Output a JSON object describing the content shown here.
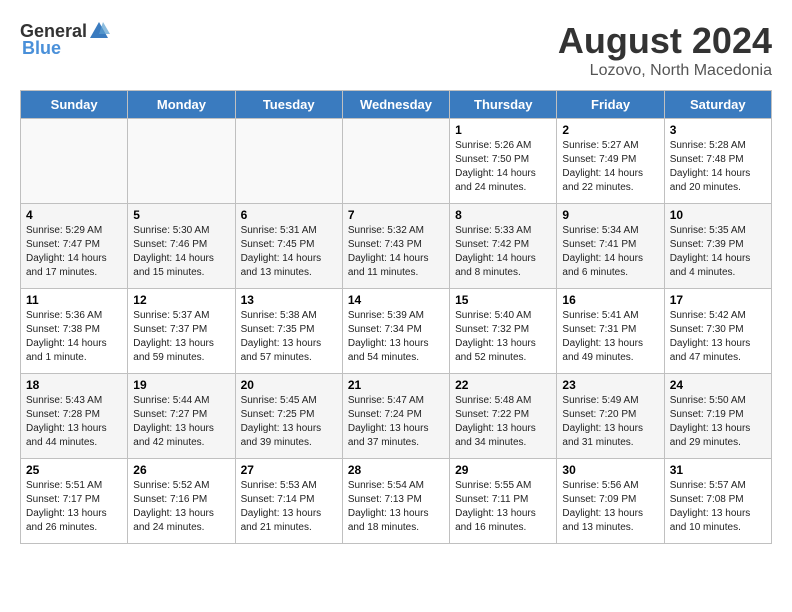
{
  "header": {
    "logo_general": "General",
    "logo_blue": "Blue",
    "month_title": "August 2024",
    "location": "Lozovo, North Macedonia"
  },
  "days_of_week": [
    "Sunday",
    "Monday",
    "Tuesday",
    "Wednesday",
    "Thursday",
    "Friday",
    "Saturday"
  ],
  "weeks": [
    [
      {
        "day": "",
        "info": ""
      },
      {
        "day": "",
        "info": ""
      },
      {
        "day": "",
        "info": ""
      },
      {
        "day": "",
        "info": ""
      },
      {
        "day": "1",
        "info": "Sunrise: 5:26 AM\nSunset: 7:50 PM\nDaylight: 14 hours\nand 24 minutes."
      },
      {
        "day": "2",
        "info": "Sunrise: 5:27 AM\nSunset: 7:49 PM\nDaylight: 14 hours\nand 22 minutes."
      },
      {
        "day": "3",
        "info": "Sunrise: 5:28 AM\nSunset: 7:48 PM\nDaylight: 14 hours\nand 20 minutes."
      }
    ],
    [
      {
        "day": "4",
        "info": "Sunrise: 5:29 AM\nSunset: 7:47 PM\nDaylight: 14 hours\nand 17 minutes."
      },
      {
        "day": "5",
        "info": "Sunrise: 5:30 AM\nSunset: 7:46 PM\nDaylight: 14 hours\nand 15 minutes."
      },
      {
        "day": "6",
        "info": "Sunrise: 5:31 AM\nSunset: 7:45 PM\nDaylight: 14 hours\nand 13 minutes."
      },
      {
        "day": "7",
        "info": "Sunrise: 5:32 AM\nSunset: 7:43 PM\nDaylight: 14 hours\nand 11 minutes."
      },
      {
        "day": "8",
        "info": "Sunrise: 5:33 AM\nSunset: 7:42 PM\nDaylight: 14 hours\nand 8 minutes."
      },
      {
        "day": "9",
        "info": "Sunrise: 5:34 AM\nSunset: 7:41 PM\nDaylight: 14 hours\nand 6 minutes."
      },
      {
        "day": "10",
        "info": "Sunrise: 5:35 AM\nSunset: 7:39 PM\nDaylight: 14 hours\nand 4 minutes."
      }
    ],
    [
      {
        "day": "11",
        "info": "Sunrise: 5:36 AM\nSunset: 7:38 PM\nDaylight: 14 hours\nand 1 minute."
      },
      {
        "day": "12",
        "info": "Sunrise: 5:37 AM\nSunset: 7:37 PM\nDaylight: 13 hours\nand 59 minutes."
      },
      {
        "day": "13",
        "info": "Sunrise: 5:38 AM\nSunset: 7:35 PM\nDaylight: 13 hours\nand 57 minutes."
      },
      {
        "day": "14",
        "info": "Sunrise: 5:39 AM\nSunset: 7:34 PM\nDaylight: 13 hours\nand 54 minutes."
      },
      {
        "day": "15",
        "info": "Sunrise: 5:40 AM\nSunset: 7:32 PM\nDaylight: 13 hours\nand 52 minutes."
      },
      {
        "day": "16",
        "info": "Sunrise: 5:41 AM\nSunset: 7:31 PM\nDaylight: 13 hours\nand 49 minutes."
      },
      {
        "day": "17",
        "info": "Sunrise: 5:42 AM\nSunset: 7:30 PM\nDaylight: 13 hours\nand 47 minutes."
      }
    ],
    [
      {
        "day": "18",
        "info": "Sunrise: 5:43 AM\nSunset: 7:28 PM\nDaylight: 13 hours\nand 44 minutes."
      },
      {
        "day": "19",
        "info": "Sunrise: 5:44 AM\nSunset: 7:27 PM\nDaylight: 13 hours\nand 42 minutes."
      },
      {
        "day": "20",
        "info": "Sunrise: 5:45 AM\nSunset: 7:25 PM\nDaylight: 13 hours\nand 39 minutes."
      },
      {
        "day": "21",
        "info": "Sunrise: 5:47 AM\nSunset: 7:24 PM\nDaylight: 13 hours\nand 37 minutes."
      },
      {
        "day": "22",
        "info": "Sunrise: 5:48 AM\nSunset: 7:22 PM\nDaylight: 13 hours\nand 34 minutes."
      },
      {
        "day": "23",
        "info": "Sunrise: 5:49 AM\nSunset: 7:20 PM\nDaylight: 13 hours\nand 31 minutes."
      },
      {
        "day": "24",
        "info": "Sunrise: 5:50 AM\nSunset: 7:19 PM\nDaylight: 13 hours\nand 29 minutes."
      }
    ],
    [
      {
        "day": "25",
        "info": "Sunrise: 5:51 AM\nSunset: 7:17 PM\nDaylight: 13 hours\nand 26 minutes."
      },
      {
        "day": "26",
        "info": "Sunrise: 5:52 AM\nSunset: 7:16 PM\nDaylight: 13 hours\nand 24 minutes."
      },
      {
        "day": "27",
        "info": "Sunrise: 5:53 AM\nSunset: 7:14 PM\nDaylight: 13 hours\nand 21 minutes."
      },
      {
        "day": "28",
        "info": "Sunrise: 5:54 AM\nSunset: 7:13 PM\nDaylight: 13 hours\nand 18 minutes."
      },
      {
        "day": "29",
        "info": "Sunrise: 5:55 AM\nSunset: 7:11 PM\nDaylight: 13 hours\nand 16 minutes."
      },
      {
        "day": "30",
        "info": "Sunrise: 5:56 AM\nSunset: 7:09 PM\nDaylight: 13 hours\nand 13 minutes."
      },
      {
        "day": "31",
        "info": "Sunrise: 5:57 AM\nSunset: 7:08 PM\nDaylight: 13 hours\nand 10 minutes."
      }
    ]
  ]
}
